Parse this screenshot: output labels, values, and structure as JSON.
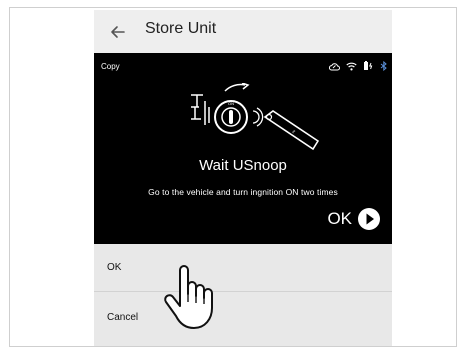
{
  "appbar": {
    "back_icon": "arrow-left-icon",
    "title": "Store Unit"
  },
  "screen": {
    "copy_label": "Copy",
    "status_icons": [
      "cloud-sync-icon",
      "wifi-icon",
      "battery-charging-icon",
      "bluetooth-icon"
    ],
    "illustration": [
      "vehicle-door-icon",
      "ignition-switch-icon",
      "usnoop-device-icon"
    ],
    "heading": "Wait USnoop",
    "instruction": "Go to the vehicle and turn ingnition ON two times",
    "ok_label": "OK"
  },
  "dialog": {
    "options": [
      "OK",
      "Cancel"
    ]
  },
  "overlay": {
    "icon": "pointing-hand-icon"
  }
}
